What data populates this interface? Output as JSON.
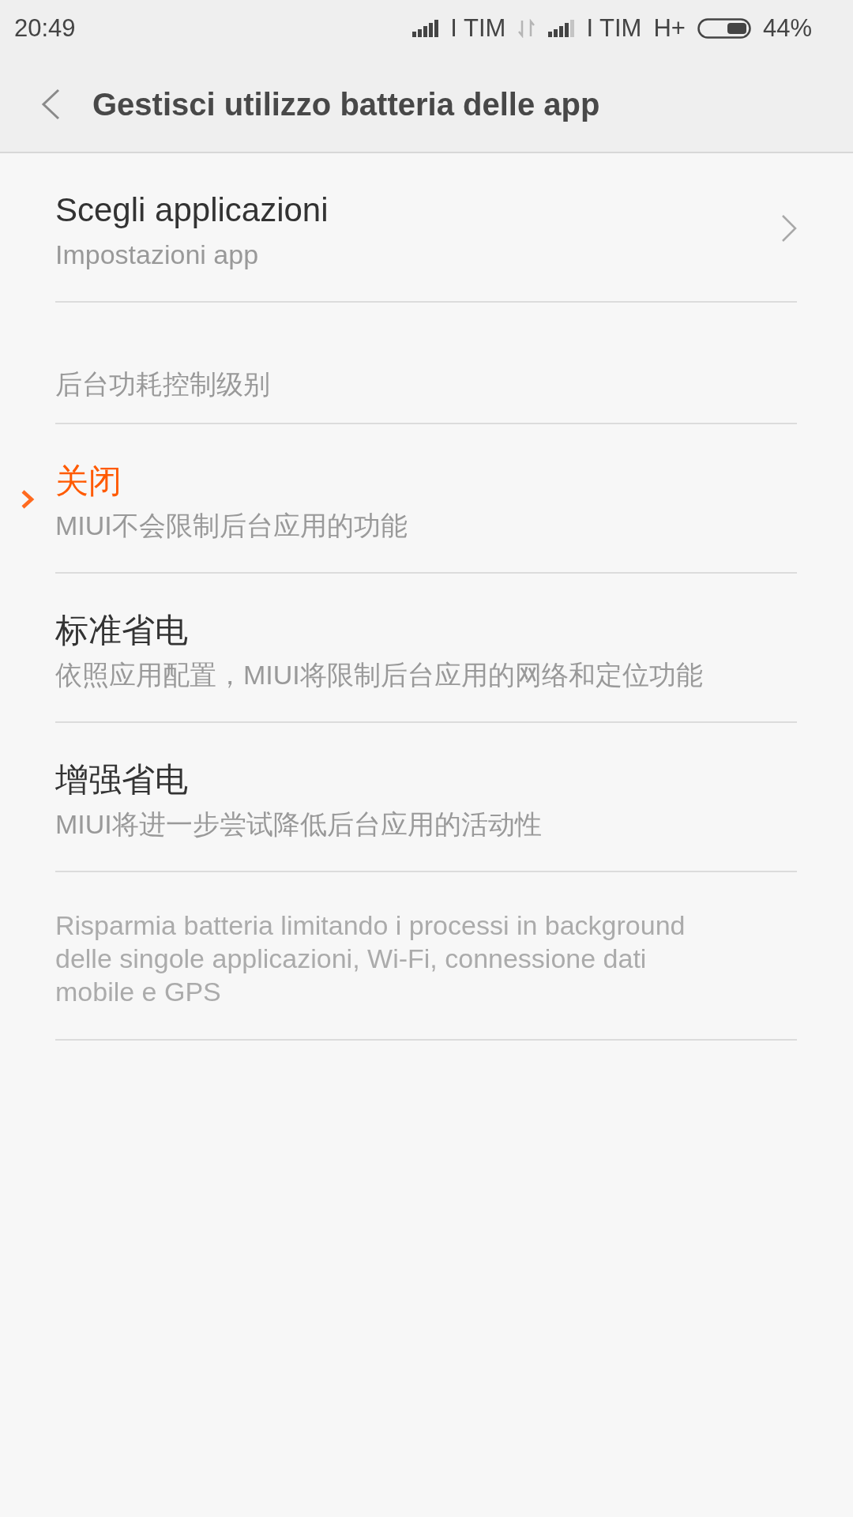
{
  "status_bar": {
    "time": "20:49",
    "sims": [
      {
        "carrier": "I TIM"
      },
      {
        "carrier": "I TIM",
        "network_type": "H+"
      }
    ],
    "battery": "44%"
  },
  "header": {
    "title": "Gestisci utilizzo batteria delle app"
  },
  "app_picker": {
    "title": "Scegli applicazioni",
    "subtitle": "Impostazioni app"
  },
  "control_level": {
    "heading": "后台功耗控制级别",
    "options": [
      {
        "title": "关闭",
        "description": "MIUI不会限制后台应用的功能",
        "selected": true
      },
      {
        "title": "标准省电",
        "description": "依照应用配置，MIUI将限制后台应用的网络和定位功能",
        "selected": false
      },
      {
        "title": "增强省电",
        "description": "MIUI将进一步尝试降低后台应用的活动性",
        "selected": false
      }
    ]
  },
  "footer_note": "Risparmia batteria limitando i processi in background delle singole applicazioni, Wi-Fi, connessione dati mobile e GPS"
}
